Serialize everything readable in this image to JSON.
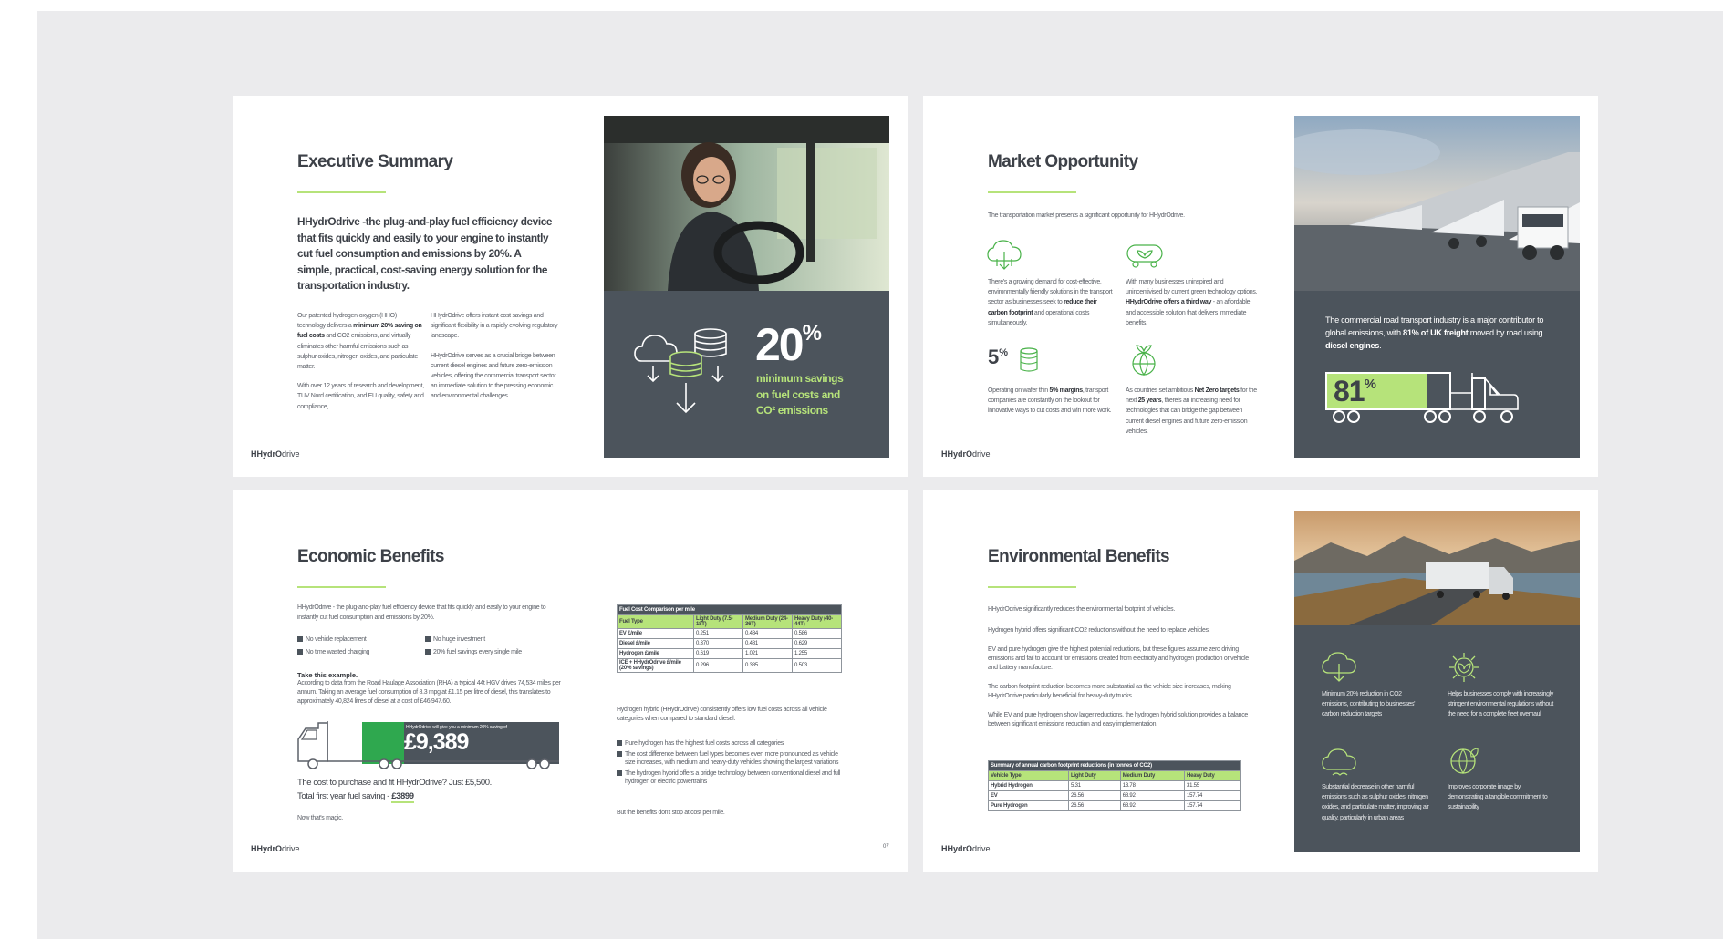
{
  "brand": {
    "logo_bold": "HHydrO",
    "logo_light": "drive",
    "accent": "#b6e37a",
    "panel": "#4c545c"
  },
  "s1": {
    "title": "Executive Summary",
    "lead": "HHydrOdrive -the plug-and-play fuel efficiency device that fits quickly and easily to your engine to instantly cut fuel consumption and emissions by 20%. A simple, practical, cost-saving energy solution for the transportation industry.",
    "col1_a1": "Our patented hydrogen-oxygen (HHO) technology delivers a ",
    "col1_b": "minimum 20% saving on fuel costs",
    "col1_a2": " and CO2 emissions, and virtually eliminates other harmful emissions such as sulphur oxides, nitrogen oxides, and particulate matter.",
    "col1_c": "With over 12 years of research and development, TUV Nord certification, and EU quality, safety and compliance,",
    "col2_a": "HHydrOdrive offers instant cost savings and significant flexibility in a rapidly evolving regulatory landscape.",
    "col2_b": "HHydrOdrive serves as a crucial bridge between current diesel engines and future zero-emission vehicles, offering the commercial transport sector an immediate solution to the pressing economic and environmental challenges.",
    "big_num": "20",
    "big_pct": "%",
    "big_cap": "minimum savings on fuel costs and CO² emissions",
    "icon": "cloud-coins-arrows-icon"
  },
  "s2": {
    "title": "Market Opportunity",
    "intro": "The transportation market presents a significant opportunity for HHydrOdrive.",
    "f1": "There's a growing demand for cost-effective, environmentally friendly solutions in the transport sector as businesses seek to ",
    "f1_b": "reduce their carbon footprint",
    "f1_c": " and operational costs simultaneously.",
    "f2": "With many businesses uninspired and unincentivised by current green technology options, ",
    "f2_b": "HHydrOdrive offers a third way",
    "f2_c": " - an affordable and accessible solution that delivers immediate benefits.",
    "f3_num": "5",
    "f3_pct": "%",
    "f3": "Operating on wafer thin ",
    "f3_b": "5% margins",
    "f3_c": ", transport companies are constantly on the lookout for innovative ways to cut costs and win more work.",
    "f4": "As countries set ambitious ",
    "f4_b": "Net Zero targets",
    "f4_c": " for the next ",
    "f4_d": "25 years",
    "f4_e": ", there's an increasing need for technologies that can bridge the gap between current diesel engines and future zero-emission vehicles.",
    "panel_a": "The commercial road transport industry is a major contributor to global emissions, with ",
    "panel_b": "81% of UK freight",
    "panel_c": " moved by road using ",
    "panel_d": "diesel engines",
    "panel_e": ".",
    "truck_num": "81",
    "truck_pct": "%",
    "truck_fill": 0.81
  },
  "s3": {
    "title": "Economic Benefits",
    "intro": "HHydrOdrive - the plug-and-play fuel efficiency device that fits quickly and easily to your engine to instantly cut fuel consumption and emissions by 20%.",
    "bullets": [
      "No vehicle replacement",
      "No huge investment",
      "No time wasted charging",
      "20% fuel savings every single mile"
    ],
    "example_title": "Take this example.",
    "example": "According to data from the Road Haulage Association (RHA) a typical 44t HGV drives 74,534 miles per annum. Taking an average fuel consumption of 8.3 mpg at £1.15 per litre of diesel, this translates to approximately 40,824 litres of diesel at a cost of £46,947.60.",
    "truck_note": "HHydrOdrive will give you a minimum 20% saving of",
    "saving": "£9,389",
    "cost_line1": "The cost to purchase and fit HHydrOdrive? Just £5,500.",
    "cost_line2": "Total first year fuel saving - ",
    "cost_value": "£3899",
    "magic": "Now that's magic.",
    "table": {
      "caption": "Fuel Cost Comparison per mile",
      "headers": [
        "Fuel Type",
        "Light Duty (7.5-18T)",
        "Medium Duty (24-36T)",
        "Heavy Duty (40-44T)"
      ],
      "rows": [
        [
          "EV £/mile",
          "0.251",
          "0.484",
          "0.586"
        ],
        [
          "Diesel £/mile",
          "0.370",
          "0.481",
          "0.629"
        ],
        [
          "Hydrogen £/mile",
          "0.619",
          "1.021",
          "1.255"
        ],
        [
          "ICE + HHydrOdrive £/mile (20% savings)",
          "0.296",
          "0.385",
          "0.503"
        ]
      ]
    },
    "right_intro": "Hydrogen hybrid (HHydrOdrive) consistently offers low fuel costs across all vehicle categories when compared to standard diesel.",
    "right_bullets": [
      "Pure hydrogen has the highest fuel costs across all categories",
      "The cost difference between fuel types becomes even more pronounced as vehicle size increases, with medium and heavy-duty vehicles showing the largest variations",
      "The hydrogen hybrid offers a bridge technology between conventional diesel and full hydrogen or electric powertrains"
    ],
    "right_end": "But the benefits don't stop at cost per mile.",
    "page_no": "07"
  },
  "s4": {
    "title": "Environmental Benefits",
    "paras": [
      "HHydrOdrive significantly reduces the environmental footprint of vehicles.",
      "Hydrogen hybrid offers significant CO2 reductions without the need to replace vehicles.",
      "EV and pure hydrogen give the highest potential reductions, but these figures assume zero driving emissions and fail to account for emissions created from electricity and hydrogen production or vehicle and battery manufacture.",
      "The carbon footprint reduction becomes more substantial as the vehicle size increases, making HHydrOdrive particularly beneficial for heavy-duty trucks.",
      "While EV and pure hydrogen show larger reductions, the hydrogen hybrid solution provides a balance between significant emissions reduction and easy implementation."
    ],
    "table": {
      "caption": "Summary of annual carbon footprint reductions (in tonnes of CO2)",
      "headers": [
        "Vehicle Type",
        "Light Duty",
        "Medium Duty",
        "Heavy Duty"
      ],
      "rows": [
        [
          "Hybrid Hydrogen",
          "5.31",
          "13.78",
          "31.55"
        ],
        [
          "EV",
          "26.56",
          "68.92",
          "157.74"
        ],
        [
          "Pure Hydrogen",
          "26.56",
          "68.92",
          "157.74"
        ]
      ]
    },
    "benefits": [
      "Minimum 20% reduction in CO2 emissions, contributing to businesses' carbon reduction targets",
      "Helps businesses comply with increasingly stringent environmental regulations without the need for a complete fleet overhaul",
      "Substantial decrease in other harmful emissions such as sulphur oxides, nitrogen oxides, and particulate matter, improving air quality, particularly in urban areas",
      "Improves corporate image by demonstrating a tangible commitment to sustainability"
    ]
  }
}
